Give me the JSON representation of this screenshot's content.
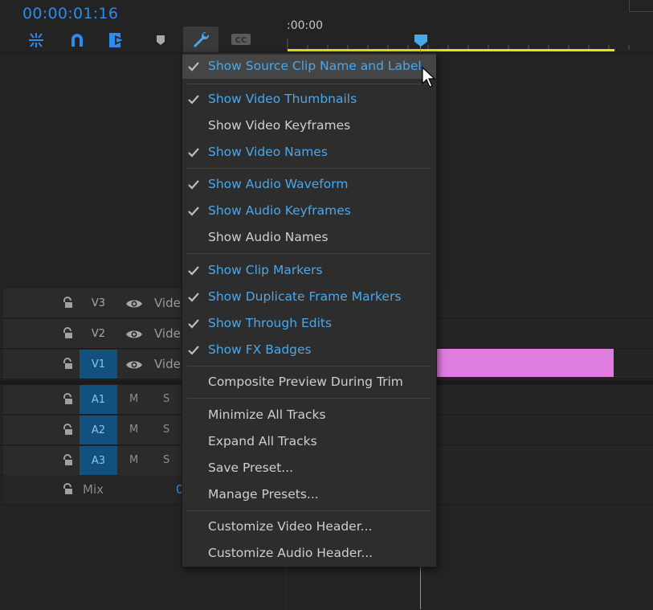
{
  "timecode": "00:00:01:16",
  "ruler_start": ":00:00",
  "toolbar": {
    "tools": [
      "insert-nest-icon",
      "snap-magnet-icon",
      "linked-selection-icon",
      "add-marker-icon",
      "timeline-settings-wrench-icon",
      "captions-cc-icon"
    ],
    "cc_label": "CC"
  },
  "colors": {
    "accent": "#2d8ceb",
    "work_area": "#e5e515",
    "clip": "#e07de0",
    "track_target": "#12507f",
    "checked_text": "#4aa8ea"
  },
  "tracks": {
    "video": [
      {
        "label": "V3",
        "name": "Vide",
        "targeted": false
      },
      {
        "label": "V2",
        "name": "Vide",
        "targeted": false
      },
      {
        "label": "V1",
        "name": "Vide",
        "targeted": true
      }
    ],
    "audio": [
      {
        "label": "A1",
        "mute": "M",
        "solo": "S",
        "targeted": true
      },
      {
        "label": "A2",
        "mute": "M",
        "solo": "S",
        "targeted": true
      },
      {
        "label": "A3",
        "mute": "M",
        "solo": "S",
        "targeted": true
      }
    ],
    "mix": {
      "label": "Mix",
      "value": "0"
    }
  },
  "menu": {
    "items": [
      {
        "label": "Show Source Clip Name and Label",
        "checked": true,
        "highlighted": true
      },
      {
        "label": "Show Video Thumbnails",
        "checked": true
      },
      {
        "label": "Show Video Keyframes",
        "checked": false
      },
      {
        "label": "Show Video Names",
        "checked": true
      },
      {
        "label": "Show Audio Waveform",
        "checked": true
      },
      {
        "label": "Show Audio Keyframes",
        "checked": true
      },
      {
        "label": "Show Audio Names",
        "checked": false
      },
      {
        "label": "Show Clip Markers",
        "checked": true
      },
      {
        "label": "Show Duplicate Frame Markers",
        "checked": true
      },
      {
        "label": "Show Through Edits",
        "checked": true
      },
      {
        "label": "Show FX Badges",
        "checked": true
      },
      {
        "label": "Composite Preview During Trim",
        "checked": false
      },
      {
        "label": "Minimize All Tracks",
        "checked": false
      },
      {
        "label": "Expand All Tracks",
        "checked": false
      },
      {
        "label": "Save Preset...",
        "checked": false
      },
      {
        "label": "Manage Presets...",
        "checked": false
      },
      {
        "label": "Customize Video Header...",
        "checked": false
      },
      {
        "label": "Customize Audio Header...",
        "checked": false
      }
    ]
  }
}
